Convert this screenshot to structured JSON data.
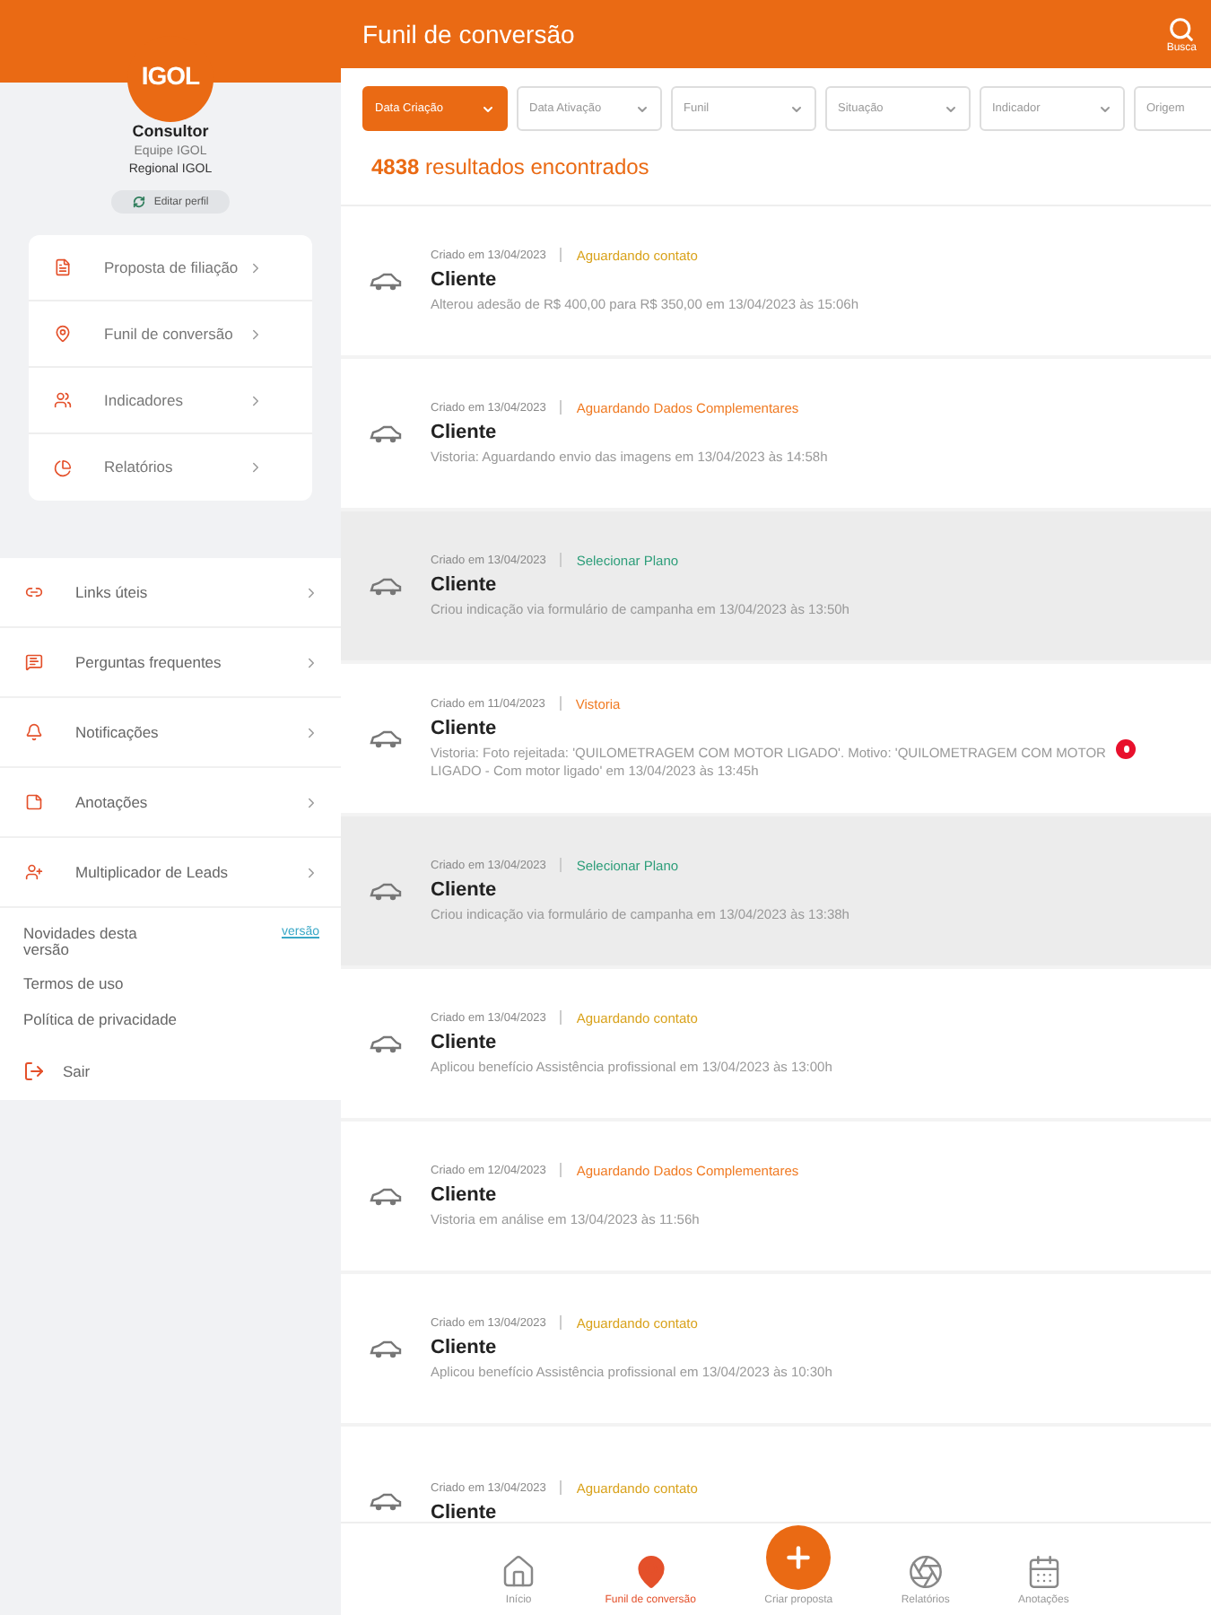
{
  "sidebar": {
    "logo": "IGOL",
    "profile": {
      "role": "Consultor",
      "team": "Equipe IGOL",
      "region": "Regional IGOL",
      "edit_button": "Editar perfil"
    },
    "primary_menu": [
      {
        "label": "Proposta de filiação"
      },
      {
        "label": "Funil de conversão"
      },
      {
        "label": "Indicadores"
      },
      {
        "label": "Relatórios"
      }
    ],
    "secondary_menu": [
      {
        "label": "Links úteis"
      },
      {
        "label": "Perguntas frequentes"
      },
      {
        "label": "Notificações"
      },
      {
        "label": "Anotações"
      },
      {
        "label": "Multiplicador de Leads"
      }
    ],
    "news": {
      "label": "Novidades desta versão",
      "link": "versão"
    },
    "links": [
      "Termos de uso",
      "Política de privacidade"
    ],
    "logout": "Sair"
  },
  "header": {
    "title": "Funil de conversão",
    "search_label": "Busca"
  },
  "filters": [
    {
      "label": "Data Criação",
      "selected": true
    },
    {
      "label": "Data Ativação",
      "selected": false
    },
    {
      "label": "Funil",
      "selected": false
    },
    {
      "label": "Situação",
      "selected": false
    },
    {
      "label": "Indicador",
      "selected": false
    },
    {
      "label": "Origem",
      "selected": false
    }
  ],
  "results": {
    "count": "4838",
    "label": "resultados encontrados"
  },
  "leads": [
    {
      "created": "Criado em 13/04/2023",
      "status": "Aguardando contato",
      "color": "#d9a21b",
      "title": "Cliente",
      "description": "Alterou adesão de R$ 400,00 para R$ 350,00 em 13/04/2023 às 15:06h",
      "selected": false,
      "alert": false
    },
    {
      "created": "Criado em 13/04/2023",
      "status": "Aguardando Dados Complementares",
      "color": "#f07a22",
      "title": "Cliente",
      "description": "Vistoria: Aguardando envio das imagens em 13/04/2023 às 14:58h",
      "selected": false,
      "alert": false
    },
    {
      "created": "Criado em 13/04/2023",
      "status": "Selecionar Plano",
      "color": "#2e9e7a",
      "title": "Cliente",
      "description": "Criou indicação via formulário de campanha em 13/04/2023 às 13:50h",
      "selected": true,
      "alert": false
    },
    {
      "created": "Criado em 11/04/2023",
      "status": "Vistoria",
      "color": "#f07a22",
      "title": "Cliente",
      "description": "Vistoria: Foto rejeitada: 'QUILOMETRAGEM COM MOTOR LIGADO'. Motivo: 'QUILOMETRAGEM COM MOTOR LIGADO - Com motor ligado' em 13/04/2023 às 13:45h",
      "selected": false,
      "alert": true
    },
    {
      "created": "Criado em 13/04/2023",
      "status": "Selecionar Plano",
      "color": "#2e9e7a",
      "title": "Cliente",
      "description": "Criou indicação via formulário de campanha em 13/04/2023 às 13:38h",
      "selected": true,
      "alert": false
    },
    {
      "created": "Criado em 13/04/2023",
      "status": "Aguardando contato",
      "color": "#d9a21b",
      "title": "Cliente",
      "description": "Aplicou benefício Assistência profissional em 13/04/2023 às 13:00h",
      "selected": false,
      "alert": false
    },
    {
      "created": "Criado em 12/04/2023",
      "status": "Aguardando Dados Complementares",
      "color": "#f07a22",
      "title": "Cliente",
      "description": "Vistoria em análise em 13/04/2023 às 11:56h",
      "selected": false,
      "alert": false
    },
    {
      "created": "Criado em 13/04/2023",
      "status": "Aguardando contato",
      "color": "#d9a21b",
      "title": "Cliente",
      "description": "Aplicou benefício Assistência profissional em 13/04/2023 às 10:30h",
      "selected": false,
      "alert": false
    },
    {
      "created": "Criado em 13/04/2023",
      "status": "Aguardando contato",
      "color": "#d9a21b",
      "title": "Cliente",
      "selected": false,
      "alert": false
    }
  ],
  "bottom_nav": [
    {
      "label": "Início",
      "kind": "tab",
      "selected": false
    },
    {
      "label": "Funil de conversão",
      "kind": "tab",
      "selected": true
    },
    {
      "label": "Criar proposta",
      "kind": "action",
      "selected": false
    },
    {
      "label": "Relatórios",
      "kind": "tab",
      "selected": false
    },
    {
      "label": "Anotações",
      "kind": "tab",
      "selected": false
    }
  ]
}
